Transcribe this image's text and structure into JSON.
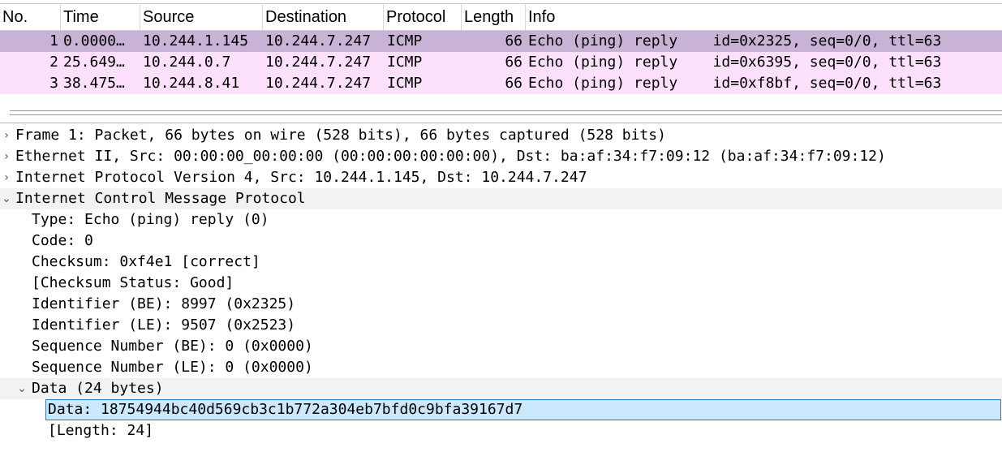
{
  "columns": {
    "no": "No.",
    "time": "Time",
    "source": "Source",
    "destination": "Destination",
    "protocol": "Protocol",
    "length": "Length",
    "info": "Info"
  },
  "packets": [
    {
      "no": "1",
      "time": "0.0000…",
      "source": "10.244.1.145",
      "destination": "10.244.7.247",
      "protocol": "ICMP",
      "length": "66",
      "info": "Echo (ping) reply    id=0x2325, seq=0/0, ttl=63"
    },
    {
      "no": "2",
      "time": "25.649…",
      "source": "10.244.0.7",
      "destination": "10.244.7.247",
      "protocol": "ICMP",
      "length": "66",
      "info": "Echo (ping) reply    id=0x6395, seq=0/0, ttl=63"
    },
    {
      "no": "3",
      "time": "38.475…",
      "source": "10.244.8.41",
      "destination": "10.244.7.247",
      "protocol": "ICMP",
      "length": "66",
      "info": "Echo (ping) reply    id=0xf8bf, seq=0/0, ttl=63"
    }
  ],
  "details": {
    "frame": "Frame 1: Packet, 66 bytes on wire (528 bits), 66 bytes captured (528 bits)",
    "ethernet": "Ethernet II, Src: 00:00:00_00:00:00 (00:00:00:00:00:00), Dst: ba:af:34:f7:09:12 (ba:af:34:f7:09:12)",
    "ipv4": "Internet Protocol Version 4, Src: 10.244.1.145, Dst: 10.244.7.247",
    "icmp": "Internet Control Message Protocol",
    "icmp_fields": {
      "type": "Type: Echo (ping) reply (0)",
      "code": "Code: 0",
      "checksum": "Checksum: 0xf4e1 [correct]",
      "checksum_status": "[Checksum Status: Good]",
      "identifier_be": "Identifier (BE): 8997 (0x2325)",
      "identifier_le": "Identifier (LE): 9507 (0x2523)",
      "seq_be": "Sequence Number (BE): 0 (0x0000)",
      "seq_le": "Sequence Number (LE): 0 (0x0000)"
    },
    "data": "Data (24 bytes)",
    "data_fields": {
      "data": "Data: 18754944bc40d569cb3c1b772a304eb7bfd0c9bfa39167d7",
      "length": "[Length: 24]"
    }
  },
  "icons": {
    "collapsed": "chevron-right-icon",
    "expanded": "chevron-down-icon",
    "sort": "sort-up-icon"
  },
  "colors": {
    "selected_row": "#c8b2d6",
    "row_background": "#fce0fc",
    "selected_field": "#cce8ff",
    "selected_field_border": "#2a7ab8"
  }
}
